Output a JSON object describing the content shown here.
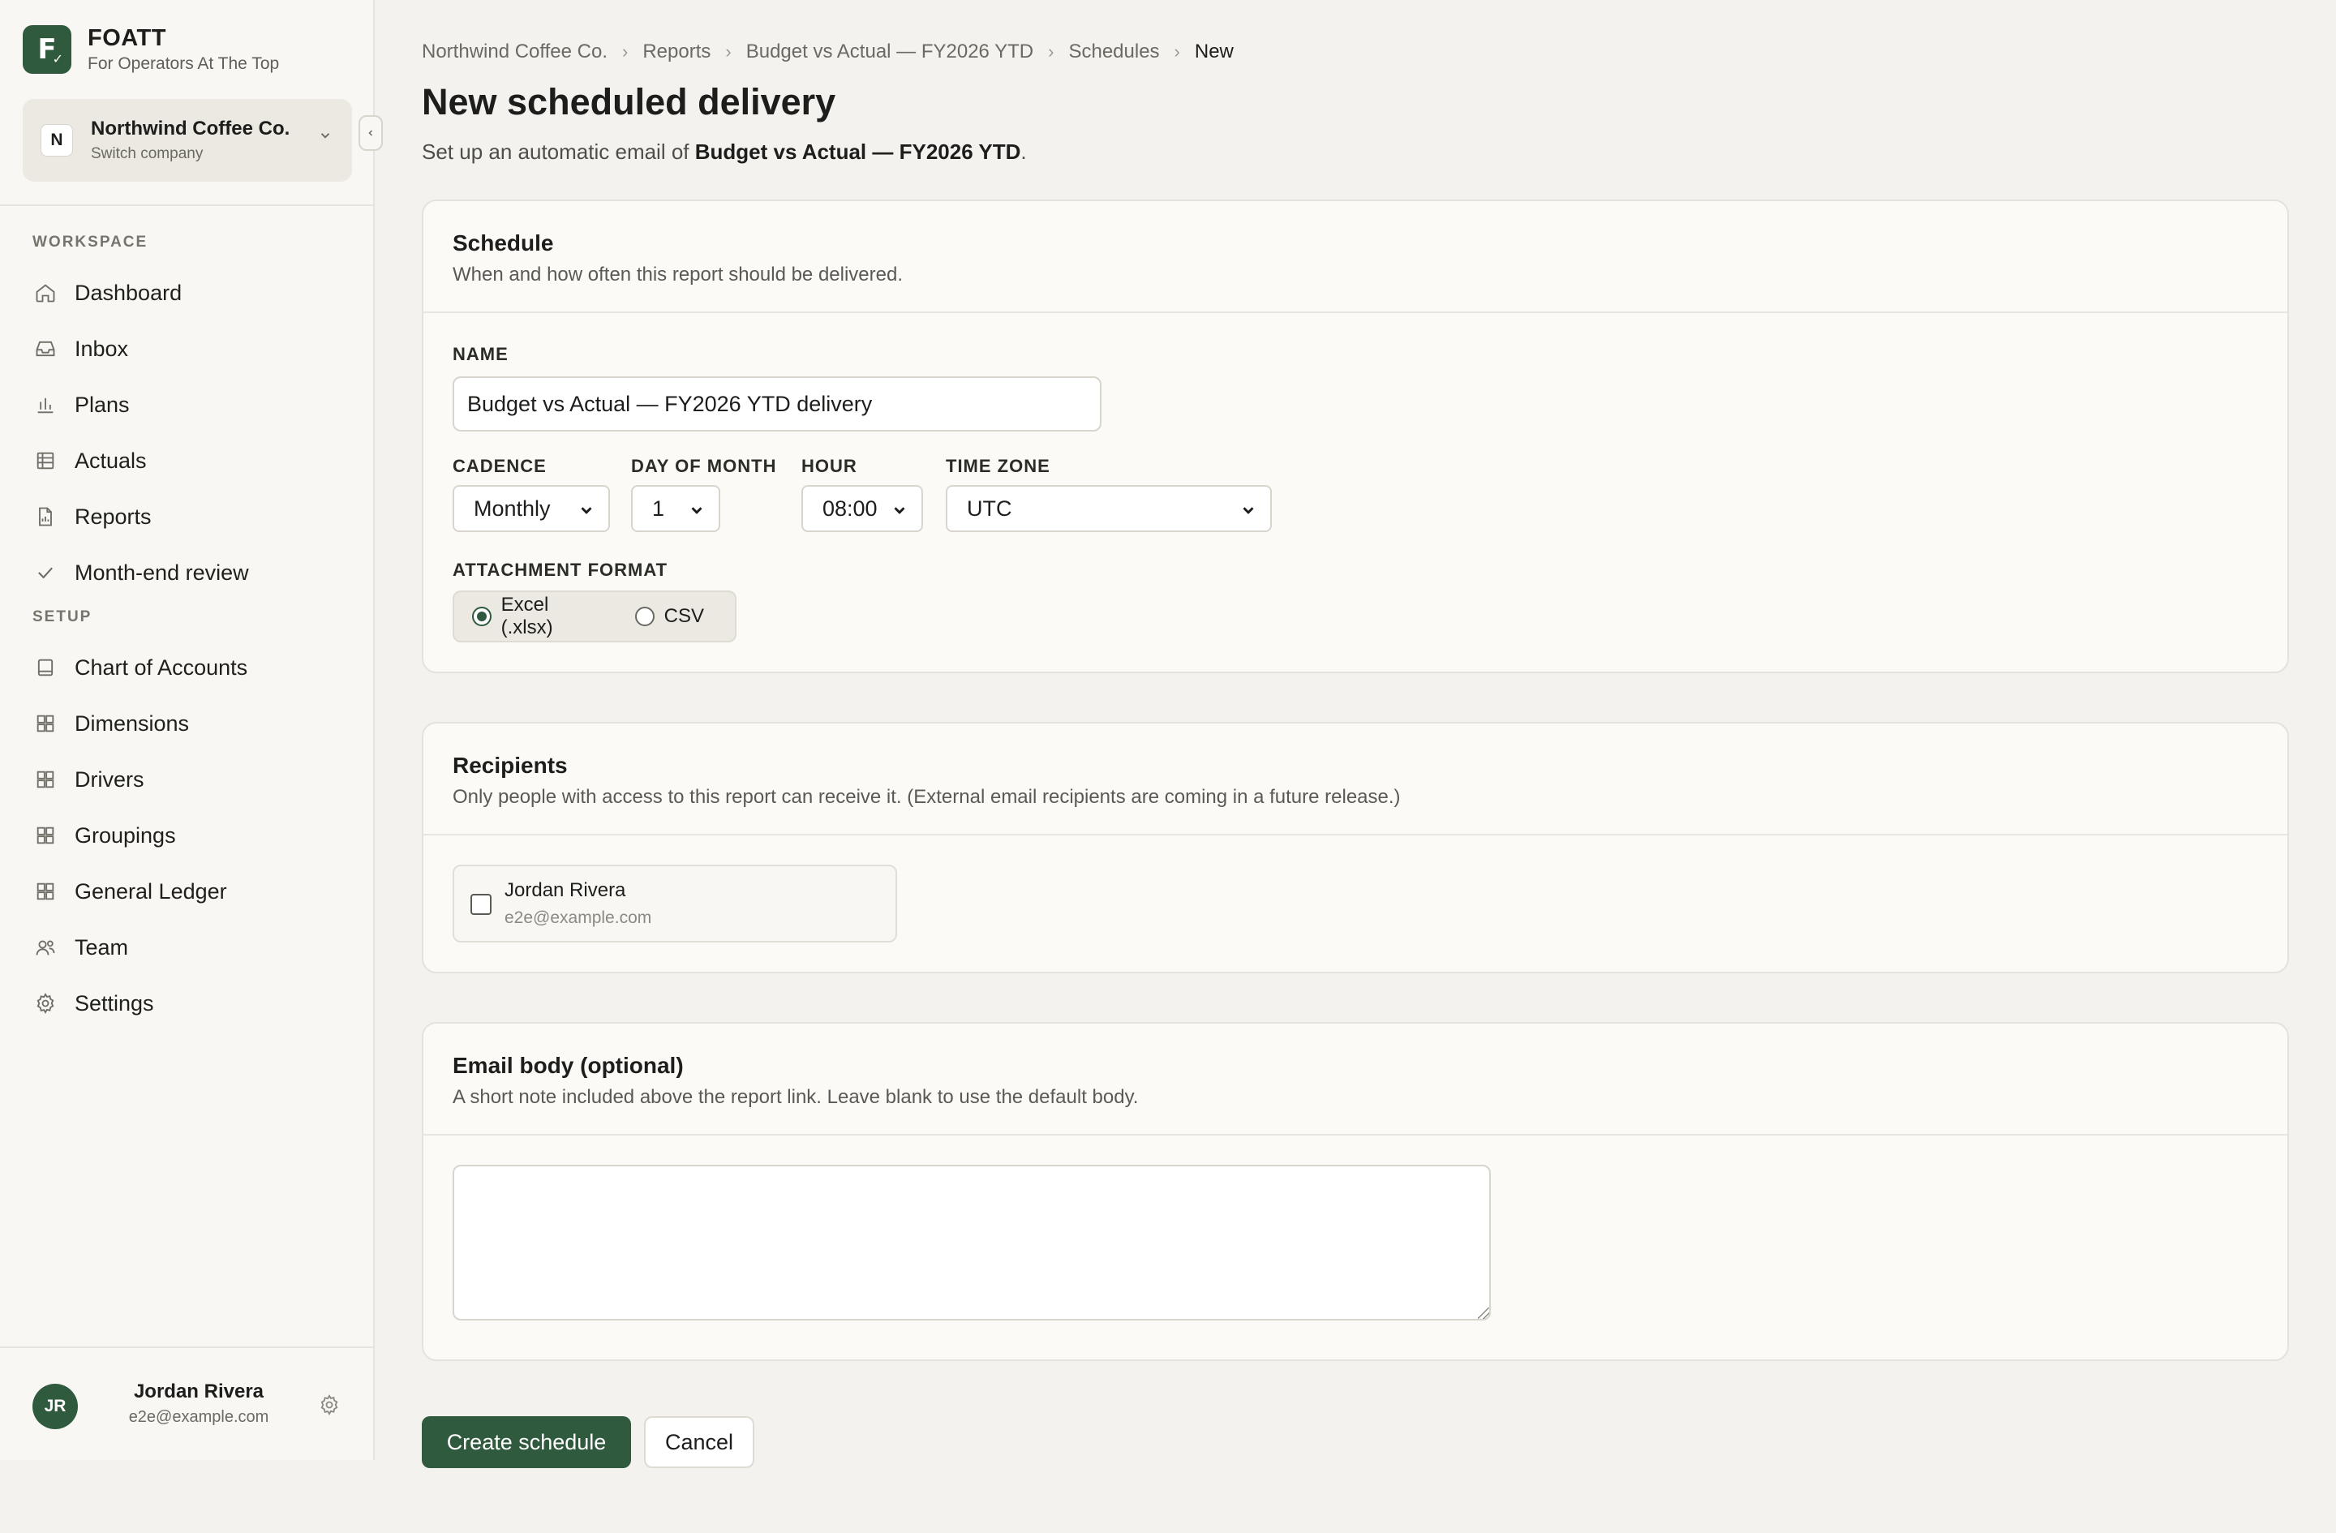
{
  "brand": {
    "name": "FOATT",
    "tagline": "For Operators At The Top",
    "logo_letter": "F"
  },
  "company": {
    "badge": "N",
    "name": "Northwind Coffee Co.",
    "sub": "Switch company"
  },
  "sidebar": {
    "workspace_label": "WORKSPACE",
    "setup_label": "SETUP",
    "workspace_items": [
      {
        "label": "Dashboard",
        "icon": "home-icon"
      },
      {
        "label": "Inbox",
        "icon": "inbox-icon"
      },
      {
        "label": "Plans",
        "icon": "bar-chart-icon"
      },
      {
        "label": "Actuals",
        "icon": "table-icon"
      },
      {
        "label": "Reports",
        "icon": "file-chart-icon"
      },
      {
        "label": "Month-end review",
        "icon": "check-icon"
      }
    ],
    "setup_items": [
      {
        "label": "Chart of Accounts",
        "icon": "book-icon"
      },
      {
        "label": "Dimensions",
        "icon": "grid-icon"
      },
      {
        "label": "Drivers",
        "icon": "grid-icon"
      },
      {
        "label": "Groupings",
        "icon": "grid-icon"
      },
      {
        "label": "General Ledger",
        "icon": "grid-icon"
      },
      {
        "label": "Team",
        "icon": "users-icon"
      },
      {
        "label": "Settings",
        "icon": "gear-icon"
      }
    ]
  },
  "user": {
    "initials": "JR",
    "name": "Jordan Rivera",
    "email": "e2e@example.com"
  },
  "breadcrumb": [
    "Northwind Coffee Co.",
    "Reports",
    "Budget vs Actual — FY2026 YTD",
    "Schedules",
    "New"
  ],
  "page": {
    "title": "New scheduled delivery",
    "subtitle_prefix": "Set up an automatic email of ",
    "subtitle_report": "Budget vs Actual — FY2026 YTD",
    "subtitle_suffix": "."
  },
  "schedule": {
    "title": "Schedule",
    "description": "When and how often this report should be delivered.",
    "name_label": "NAME",
    "name_value": "Budget vs Actual — FY2026 YTD delivery",
    "cadence_label": "CADENCE",
    "cadence_value": "Monthly",
    "day_label": "DAY OF MONTH",
    "day_value": "1",
    "hour_label": "HOUR",
    "hour_value": "08:00",
    "tz_label": "TIME ZONE",
    "tz_value": "UTC",
    "format_label": "ATTACHMENT FORMAT",
    "format_options": [
      "Excel (.xlsx)",
      "CSV"
    ],
    "format_selected": "Excel (.xlsx)"
  },
  "recipients": {
    "title": "Recipients",
    "description": "Only people with access to this report can receive it. (External email recipients are coming in a future release.)",
    "people": [
      {
        "name": "Jordan Rivera",
        "email": "e2e@example.com",
        "checked": false
      }
    ]
  },
  "email_body": {
    "title": "Email body (optional)",
    "description": "A short note included above the report link. Leave blank to use the default body.",
    "value": ""
  },
  "actions": {
    "create": "Create schedule",
    "cancel": "Cancel"
  },
  "colors": {
    "accent": "#2f5a3e",
    "background": "#f3f2ee",
    "sidebar": "#f8f7f3"
  }
}
